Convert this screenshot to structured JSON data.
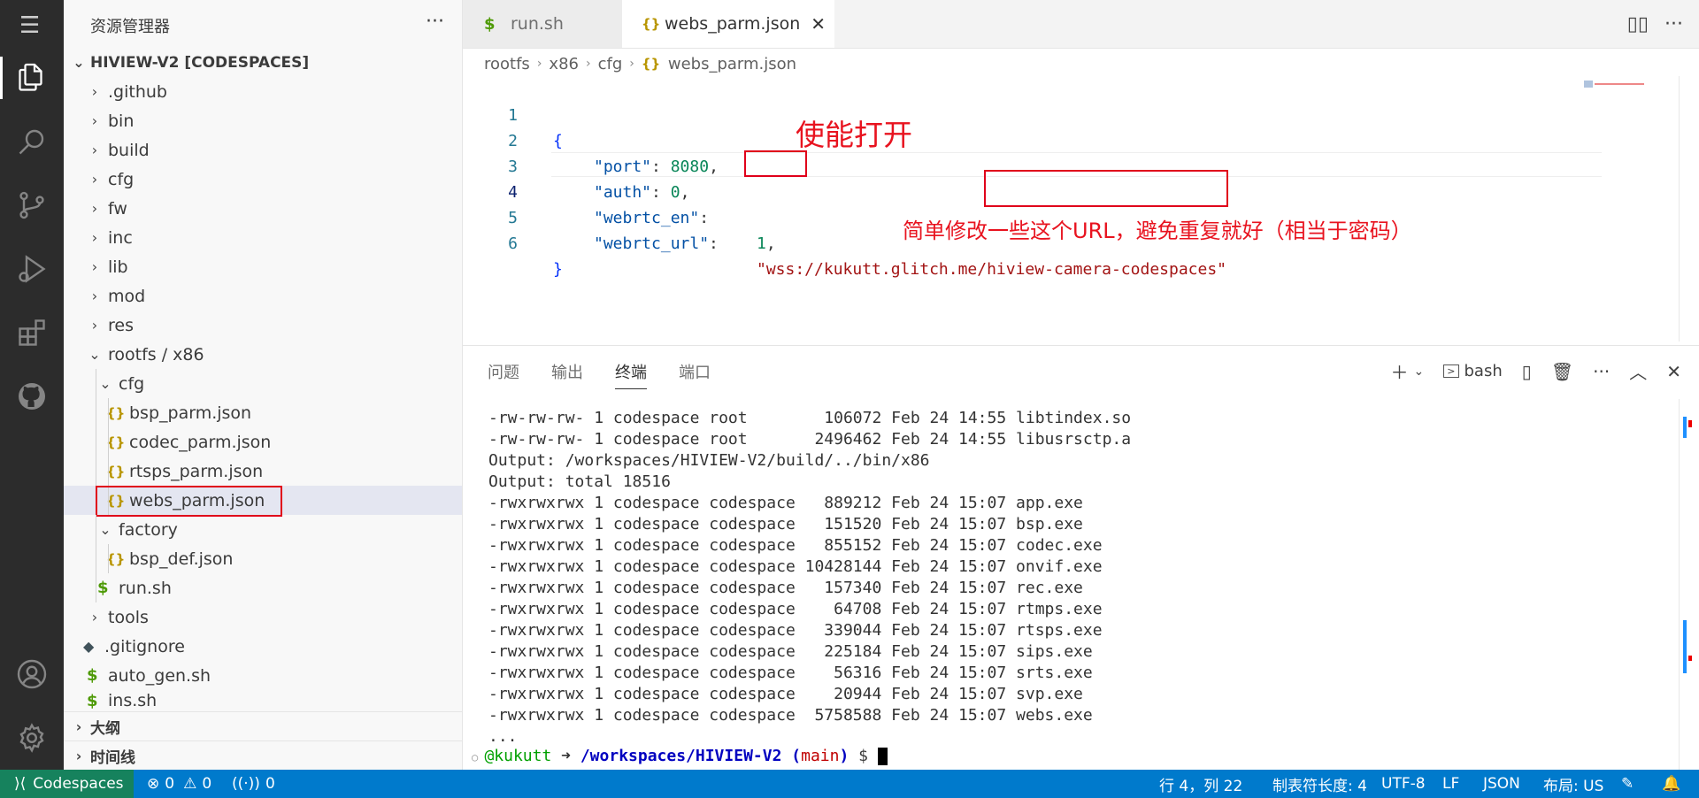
{
  "activity_bar": {
    "items": [
      "files-icon",
      "search-icon",
      "source-control-icon",
      "run-debug-icon",
      "extensions-icon",
      "github-icon"
    ],
    "bottom": [
      "account-icon",
      "settings-gear-icon"
    ]
  },
  "sidebar": {
    "title": "资源管理器",
    "more": "···",
    "root": "HIVIEW-V2 [CODESPACES]",
    "items": [
      {
        "label": ".github",
        "type": "folder"
      },
      {
        "label": "bin",
        "type": "folder"
      },
      {
        "label": "build",
        "type": "folder"
      },
      {
        "label": "cfg",
        "type": "folder"
      },
      {
        "label": "fw",
        "type": "folder"
      },
      {
        "label": "inc",
        "type": "folder"
      },
      {
        "label": "lib",
        "type": "folder"
      },
      {
        "label": "mod",
        "type": "folder"
      },
      {
        "label": "res",
        "type": "folder"
      },
      {
        "label": "rootfs / x86",
        "type": "folder-open"
      },
      {
        "label": "cfg",
        "type": "folder-open"
      },
      {
        "label": "bsp_parm.json",
        "type": "json"
      },
      {
        "label": "codec_parm.json",
        "type": "json"
      },
      {
        "label": "rtsps_parm.json",
        "type": "json"
      },
      {
        "label": "webs_parm.json",
        "type": "json"
      },
      {
        "label": "factory",
        "type": "folder-open"
      },
      {
        "label": "bsp_def.json",
        "type": "json"
      },
      {
        "label": "run.sh",
        "type": "sh"
      },
      {
        "label": "tools",
        "type": "folder"
      },
      {
        "label": ".gitignore",
        "type": "git"
      },
      {
        "label": "auto_gen.sh",
        "type": "sh"
      },
      {
        "label": "ins.sh",
        "type": "sh"
      }
    ],
    "outline": "大纲",
    "timeline": "时间线"
  },
  "tabs": [
    {
      "label": "run.sh",
      "icon": "$"
    },
    {
      "label": "webs_parm.json",
      "icon": "{}"
    }
  ],
  "breadcrumb": [
    "rootfs",
    "x86",
    "cfg",
    "webs_parm.json"
  ],
  "code": {
    "line_numbers": [
      "1",
      "2",
      "3",
      "4",
      "5",
      "6"
    ],
    "l1": "{",
    "l2_key": "\"port\"",
    "l2_val": "8080",
    "l3_key": "\"auth\"",
    "l3_val": "0",
    "l4_key": "\"webrtc_en\"",
    "l4_val": "1",
    "l5_key": "\"webrtc_url\"",
    "l5_val": "\"wss://kukutt.glitch.me/hiview-camera-codespaces\"",
    "l6": "}"
  },
  "annotations": {
    "enable": "使能打开",
    "url_note": "简单修改一些这个URL，避免重复就好（相当于密码）"
  },
  "panel": {
    "tabs": [
      "问题",
      "输出",
      "终端",
      "端口"
    ],
    "active_tab": "终端",
    "shell": "bash",
    "lines": [
      "-rw-rw-rw- 1 codespace root        106072 Feb 24 14:55 libtindex.so",
      "-rw-rw-rw- 1 codespace root       2496462 Feb 24 14:55 libusrsctp.a",
      "Output: /workspaces/HIVIEW-V2/build/../bin/x86",
      "Output: total 18516",
      "-rwxrwxrwx 1 codespace codespace   889212 Feb 24 15:07 app.exe",
      "-rwxrwxrwx 1 codespace codespace   151520 Feb 24 15:07 bsp.exe",
      "-rwxrwxrwx 1 codespace codespace   855152 Feb 24 15:07 codec.exe",
      "-rwxrwxrwx 1 codespace codespace 10428144 Feb 24 15:07 onvif.exe",
      "-rwxrwxrwx 1 codespace codespace   157340 Feb 24 15:07 rec.exe",
      "-rwxrwxrwx 1 codespace codespace    64708 Feb 24 15:07 rtmps.exe",
      "-rwxrwxrwx 1 codespace codespace   339044 Feb 24 15:07 rtsps.exe",
      "-rwxrwxrwx 1 codespace codespace   225184 Feb 24 15:07 sips.exe",
      "-rwxrwxrwx 1 codespace codespace    56316 Feb 24 15:07 srts.exe",
      "-rwxrwxrwx 1 codespace codespace    20944 Feb 24 15:07 svp.exe",
      "-rwxrwxrwx 1 codespace codespace  5758588 Feb 24 15:07 webs.exe",
      "..."
    ],
    "prompt_user": "@kukutt",
    "prompt_arrow": "➜",
    "prompt_path": "/workspaces/HIVIEW-V2",
    "prompt_branch_open": "(",
    "prompt_branch": "main",
    "prompt_branch_close": ")",
    "prompt_symbol": "$"
  },
  "statusbar": {
    "remote": "Codespaces",
    "errors": "0",
    "warnings": "0",
    "ports": "0",
    "position": "行 4，列 22",
    "tab_size": "制表符长度: 4",
    "encoding": "UTF-8",
    "eol": "LF",
    "language": "JSON",
    "layout": "布局: US"
  }
}
